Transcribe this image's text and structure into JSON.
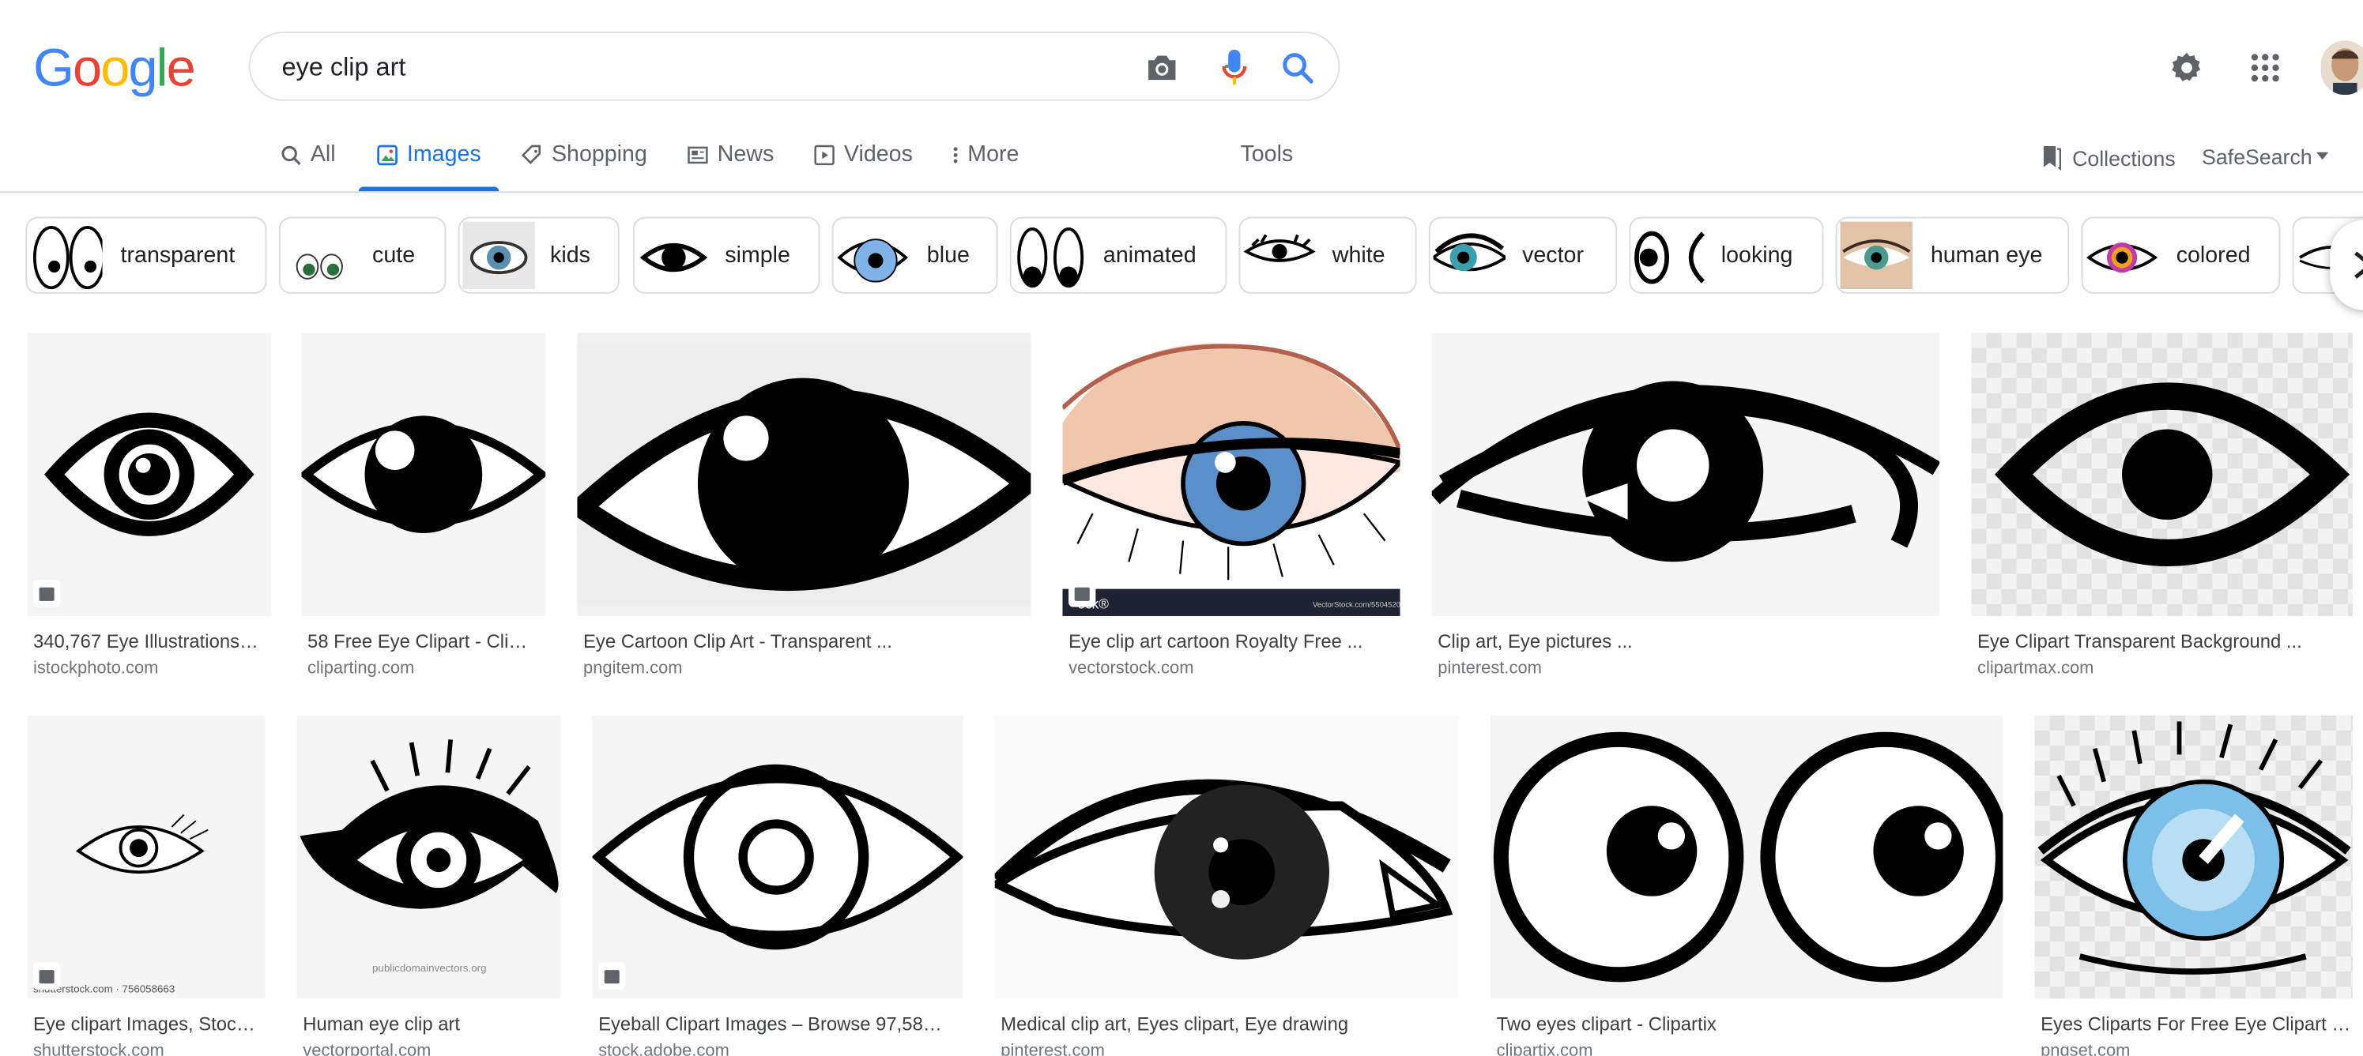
{
  "logo": {
    "g": "G",
    "o1": "o",
    "o2": "o",
    "g2": "g",
    "l": "l",
    "e": "e"
  },
  "search": {
    "query": "eye clip art"
  },
  "tabs": [
    {
      "label": "All"
    },
    {
      "label": "Images"
    },
    {
      "label": "Shopping"
    },
    {
      "label": "News"
    },
    {
      "label": "Videos"
    },
    {
      "label": "More"
    }
  ],
  "tools": {
    "label": "Tools"
  },
  "collections": {
    "label": "Collections"
  },
  "safesearch": {
    "label": "SafeSearch"
  },
  "chips": [
    {
      "label": "transparent"
    },
    {
      "label": "cute"
    },
    {
      "label": "kids"
    },
    {
      "label": "simple"
    },
    {
      "label": "blue"
    },
    {
      "label": "animated"
    },
    {
      "label": "white"
    },
    {
      "label": "vector"
    },
    {
      "label": "looking"
    },
    {
      "label": "human eye"
    },
    {
      "label": "colored"
    }
  ],
  "results": [
    {
      "title": "340,767 Eye Illustrations…",
      "site": "istockphoto.com"
    },
    {
      "title": "58 Free Eye Clipart - Clip…",
      "site": "cliparting.com"
    },
    {
      "title": "Eye Cartoon Clip Art - Transparent ...",
      "site": "pngitem.com"
    },
    {
      "title": "Eye clip art cartoon Royalty Free ...",
      "site": "vectorstock.com"
    },
    {
      "title": "Clip art, Eye pictures ...",
      "site": "pinterest.com"
    },
    {
      "title": "Eye Clipart Transparent Background ...",
      "site": "clipartmax.com"
    },
    {
      "title": "Eye clipart Images, Stoc…",
      "site": "shutterstock.com"
    },
    {
      "title": "Human eye clip art",
      "site": "vectorportal.com"
    },
    {
      "title": "Eyeball Clipart Images – Browse 97,58…",
      "site": "stock.adobe.com"
    },
    {
      "title": "Medical clip art, Eyes clipart, Eye drawing",
      "site": "pinterest.com"
    },
    {
      "title": "Two eyes clipart - Clipartix",
      "site": "clipartix.com"
    },
    {
      "title": "Eyes Cliparts For Free Eye Clipart …",
      "site": "pngset.com"
    }
  ],
  "watermarks": {
    "vectorstock": "ock®",
    "vectorstock_id": "VectorStock.com/5504520",
    "shutterstock": "shutterstock.com · 756058663",
    "publicdomain": "publicdomainvectors.org"
  },
  "colors": {
    "accent": "#1a73e8",
    "blue": "#4285F4",
    "red": "#EA4335",
    "yellow": "#FBBC05",
    "green": "#34A853"
  }
}
